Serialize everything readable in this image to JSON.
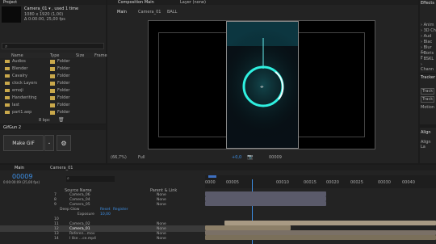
{
  "project": {
    "tab": "Project",
    "item_name": "Camera_01 ▾ , used 1 time",
    "item_dims": "1080 x 1920 (1,00)",
    "item_dur": "Δ 0:00:00, 25,00 fps",
    "search_placeholder": "🔍",
    "cols": [
      "Name",
      "Type",
      "Size",
      "Frame"
    ],
    "rows": [
      {
        "name": "Audios",
        "type": "Folder"
      },
      {
        "name": "Blender",
        "type": "Folder"
      },
      {
        "name": "Cavalry",
        "type": "Folder"
      },
      {
        "name": "clock Layers",
        "type": "Folder"
      },
      {
        "name": "emoji",
        "type": "Folder"
      },
      {
        "name": "Handwriting",
        "type": "Folder"
      },
      {
        "name": "last",
        "type": "Folder"
      },
      {
        "name": "part1.aep",
        "type": "Folder"
      }
    ],
    "bpc": "8 bpc"
  },
  "gifgun": {
    "tab": "GifGun 2",
    "make_label": "Make GIF"
  },
  "comp": {
    "tab": "Composition Main",
    "layer_tab": "Layer (none)",
    "breadcrumbs": [
      "Main",
      "Camera_01",
      "BALL"
    ],
    "zoom": "(66,7%)",
    "quality": "Full",
    "exposure": "+0,0",
    "timecode": "00009"
  },
  "right": {
    "effects_title": "Effects",
    "effects": [
      "› Anim",
      "› 3D Ch",
      "› Aud",
      "› Blac",
      "› Blur &",
      "› Boris F",
      "› BSKL",
      "› Chann"
    ],
    "tracker_title": "Tracker",
    "tracker_btns": [
      "Track",
      "Track",
      "Motion"
    ],
    "align_title": "Align",
    "align_sub": "Align La"
  },
  "timeline": {
    "tab_main": "Main",
    "tab_cam": "Camera_01",
    "timecode": "00009",
    "timecode_sub": "0:00:00:09 (25,00 fps)",
    "header": [
      "#",
      "Source Name",
      "Parent & Link"
    ],
    "ruler": [
      "0000",
      "00005",
      "00010",
      "00015",
      "00020",
      "00025",
      "00030",
      "00040"
    ],
    "layers": [
      {
        "num": "7",
        "name": "Camera_06",
        "parent": "None"
      },
      {
        "num": "8",
        "name": "Camera_04",
        "parent": "None"
      },
      {
        "num": "9",
        "name": "Camera_05",
        "parent": "None"
      },
      {
        "num": "",
        "name": "Deep Glow",
        "parent": ""
      },
      {
        "num": "",
        "name": "Exposure",
        "parent": "10,00"
      },
      {
        "num": "10",
        "name": "",
        "parent": ""
      },
      {
        "num": "11",
        "name": "Camera_02",
        "parent": "None"
      },
      {
        "num": "12",
        "name": "Camera_01",
        "parent": "None"
      },
      {
        "num": "13",
        "name": "Referen...mov",
        "parent": "None"
      },
      {
        "num": "14",
        "name": "I like ...ce.mp4",
        "parent": "None"
      }
    ],
    "reset": "Reset",
    "register": "Register"
  }
}
